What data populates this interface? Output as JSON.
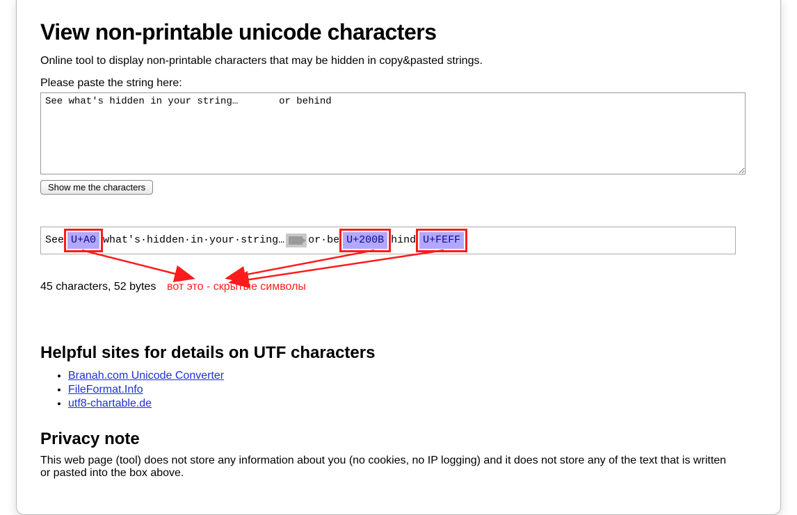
{
  "title": "View non-printable unicode characters",
  "description": "Online tool to display non-printable characters that may be hidden in copy&pasted strings.",
  "input_label": "Please paste the string here:",
  "textarea_value": "See what's hidden in your string…\tor behind​",
  "show_button": "Show me the characters",
  "result": {
    "parts": {
      "p0": "See",
      "p1": "U+A0",
      "p2": "what's·hidden·in·your·string…",
      "tab": "⟶",
      "p3": "or·be",
      "p4": "U+200B",
      "p5": "hind",
      "p6": "U+FEFF"
    },
    "summary": "45 characters, 52 bytes"
  },
  "annotation": "вот это - скрытые символы",
  "helpful": {
    "heading": "Helpful sites for details on UTF characters",
    "links": [
      {
        "label": "Branah.com Unicode Converter"
      },
      {
        "label": "FileFormat.Info"
      },
      {
        "label": "utf8-chartable.de"
      }
    ]
  },
  "privacy": {
    "heading": "Privacy note",
    "text": "This web page (tool) does not store any information about you (no cookies, no IP logging) and it does not store any of the text that is written or pasted into the box above."
  }
}
